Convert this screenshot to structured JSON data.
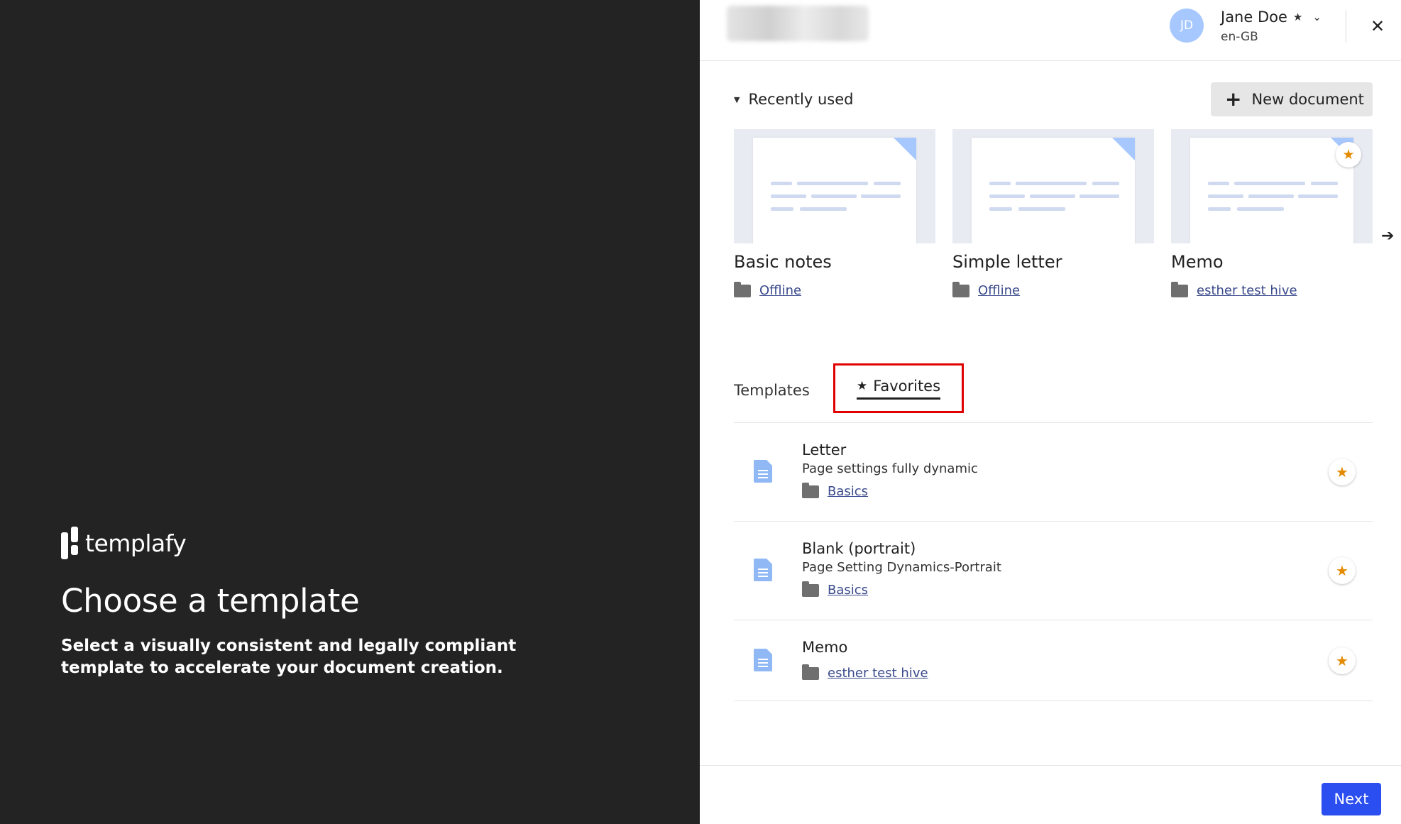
{
  "brand": {
    "name": "templafy"
  },
  "hero": {
    "title": "Choose a template",
    "subtitle": "Select a visually consistent and legally compliant template to accelerate your document creation."
  },
  "user": {
    "initials": "JD",
    "name": "Jane Doe",
    "locale": "en-GB",
    "star": "★",
    "chevron": "⌄"
  },
  "close": "✕",
  "recent": {
    "heading": "Recently used",
    "new_document_label": "New document",
    "cards": [
      {
        "title": "Basic notes",
        "folder": "Offline",
        "favorite": false
      },
      {
        "title": "Simple letter",
        "folder": "Offline",
        "favorite": false
      },
      {
        "title": "Memo",
        "folder": "esther test hive",
        "favorite": true
      }
    ],
    "next_arrow": "➔"
  },
  "tabs": {
    "templates": "Templates",
    "favorites": "Favorites"
  },
  "favorites": [
    {
      "title": "Letter",
      "subtitle": "Page settings fully dynamic",
      "folder": "Basics"
    },
    {
      "title": "Blank (portrait)",
      "subtitle": "Page Setting Dynamics-Portrait",
      "folder": "Basics"
    },
    {
      "title": "Memo",
      "subtitle": "",
      "folder": "esther test hive"
    }
  ],
  "footer": {
    "next_label": "Next"
  },
  "colors": {
    "accent": "#2b4ef0",
    "favorite_star": "#e38a00",
    "highlight_box": "#e00000",
    "left_panel": "#232323"
  }
}
